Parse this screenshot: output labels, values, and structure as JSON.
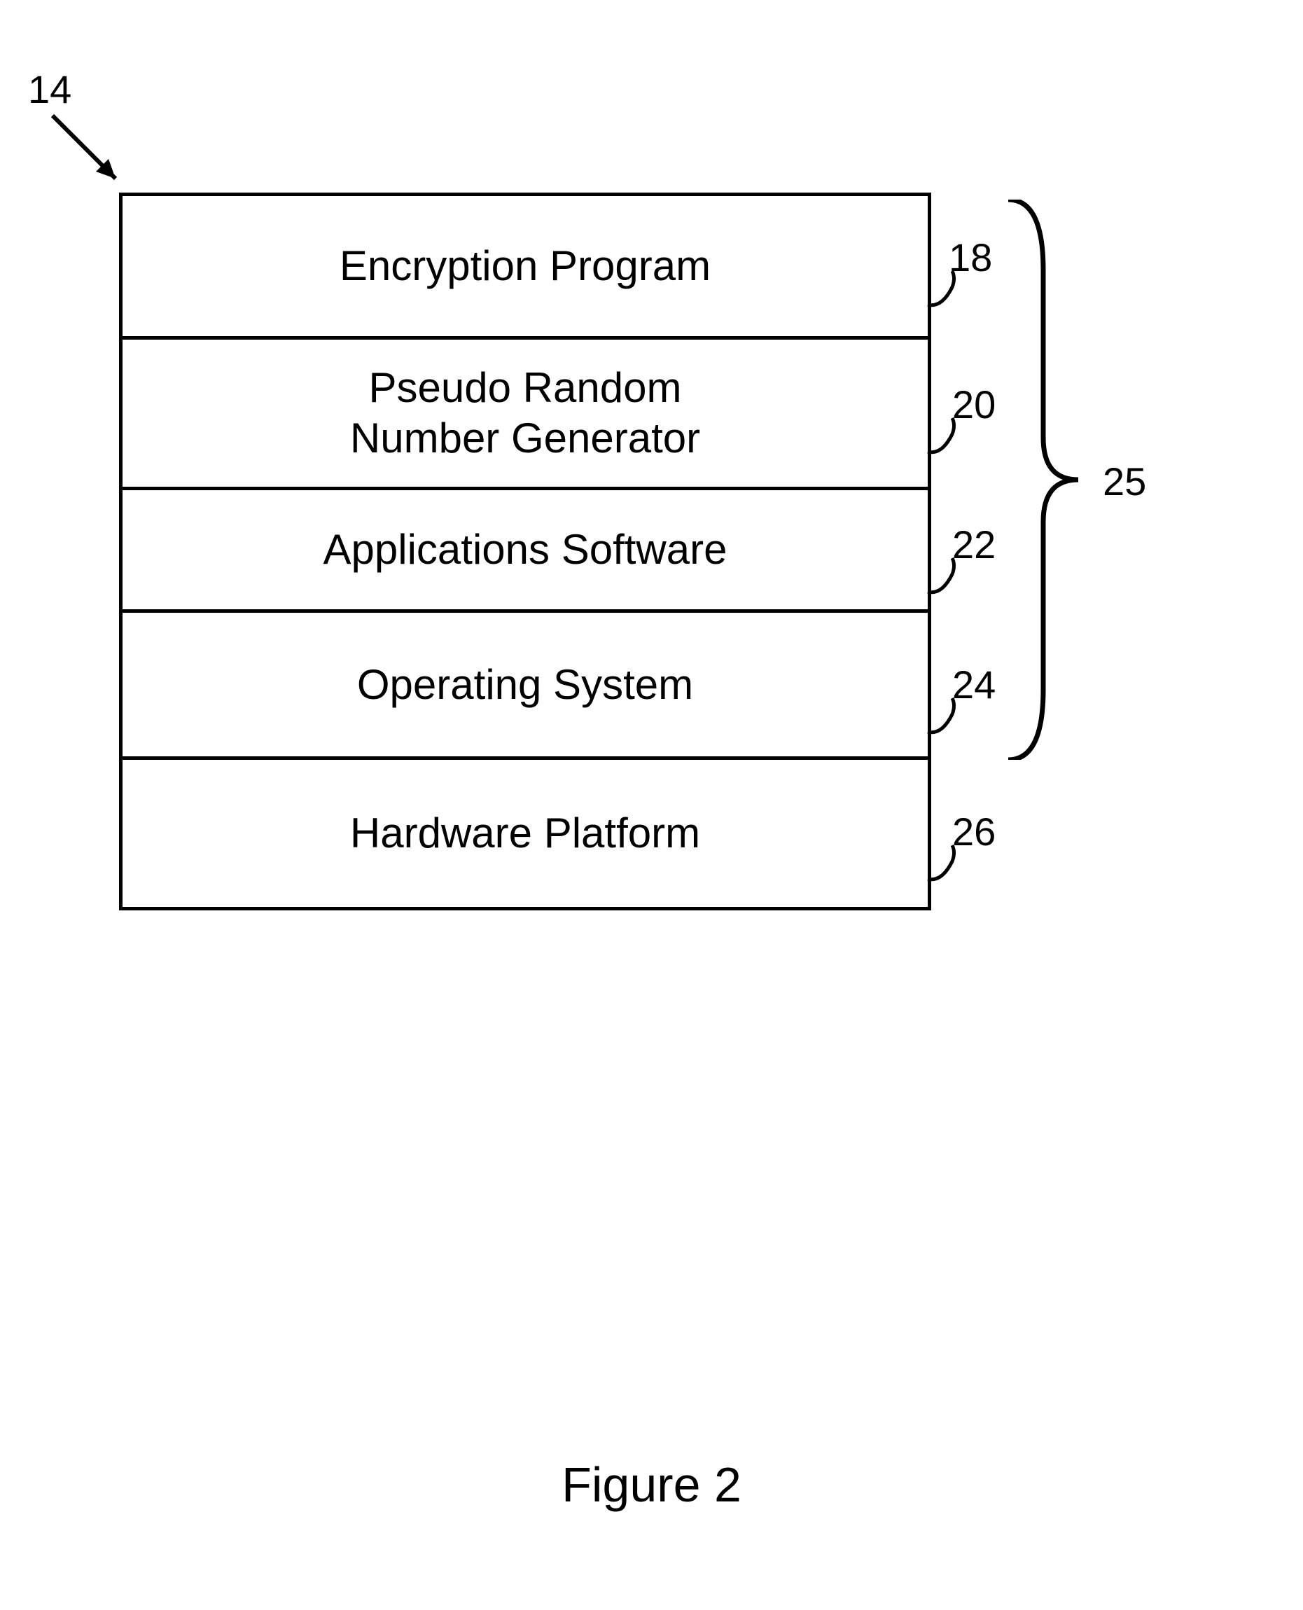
{
  "refs": {
    "stack_pointer": "14",
    "layer_encryption": "18",
    "layer_prng": "20",
    "layer_apps": "22",
    "layer_os": "24",
    "layer_hw": "26",
    "brace": "25"
  },
  "layers": {
    "encryption": "Encryption Program",
    "prng": "Pseudo Random\nNumber Generator",
    "apps": "Applications Software",
    "os": "Operating System",
    "hw": "Hardware Platform"
  },
  "caption": "Figure 2"
}
